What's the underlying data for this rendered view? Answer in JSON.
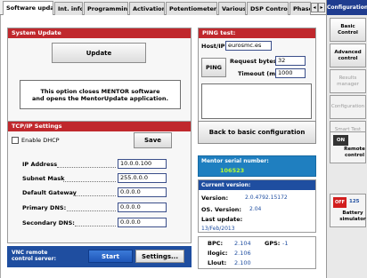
{
  "tabs": [
    {
      "label": "Software update",
      "active": true
    },
    {
      "label": "Int. info"
    },
    {
      "label": "Programming"
    },
    {
      "label": "Activation"
    },
    {
      "label": "Potentiometers"
    },
    {
      "label": "Various"
    },
    {
      "label": "DSP Control"
    },
    {
      "label": "Phase"
    }
  ],
  "system_update": {
    "title": "System Update",
    "update_label": "Update",
    "info_line1": "This option closes MENTOR software",
    "info_line2": "and opens the MentorUpdate application."
  },
  "tcpip": {
    "title": "TCP/IP Settings",
    "enable_dhcp_label": "Enable DHCP",
    "save_label": "Save",
    "ip_label": "IP Address",
    "ip_value": "10.0.0.100",
    "mask_label": "Subnet Mask",
    "mask_value": "255.0.0.0",
    "gateway_label": "Default Gateway",
    "gateway_value": "0.0.0.0",
    "dns1_label": "Primary DNS:",
    "dns1_value": "0.0.0.0",
    "dns2_label": "Secondary DNS:",
    "dns2_value": "0.0.0.0"
  },
  "vnc": {
    "label_line1": "VNC remote",
    "label_line2": "control server:",
    "start_label": "Start",
    "settings_label": "Settings..."
  },
  "ping": {
    "title": "PING test:",
    "host_label": "Host/IP",
    "host_value": "eurosmc.es",
    "ping_label": "PING",
    "request_bytes_label": "Request bytes:",
    "request_bytes_value": "32",
    "timeout_label": "Timeout (ms):",
    "timeout_value": "1000"
  },
  "back_label": "Back to basic configuration",
  "serial": {
    "label": "Mentor serial number:",
    "value": "106523"
  },
  "version": {
    "title": "Current version:",
    "version_label": "Version:",
    "version_value": "2.0.4792.15172",
    "os_label": "OS. Version:",
    "os_value": "2.04",
    "last_update_label": "Last update:",
    "last_update_value": "13/Feb/2013"
  },
  "firmware": {
    "bpc_label": "BPC:",
    "bpc_value": "2.104",
    "gps_label": "GPS:",
    "gps_value": "-1",
    "ilogic_label": "Ilogic:",
    "ilogic_value": "2.106",
    "lout_label": "Llout:",
    "lout_value": "2.100"
  },
  "sidebar": {
    "title": "Configuration",
    "basic_control": "Basic Control",
    "advanced_control": "Advanced control",
    "results_manager": "Results manager",
    "configuration": "Configuration",
    "smart_test_tools": "Smart Test Tools",
    "on_label": "ON",
    "remote_control": "Remote control",
    "off_label": "OFF",
    "battery_value": "125",
    "battery_simulator": "Battery simulator"
  },
  "colors": {
    "header_red": "#c0282d",
    "accent_blue": "#1f4ea0",
    "serial_bg": "#1f7fc0",
    "sidebar_blue": "#1f3c8f"
  }
}
